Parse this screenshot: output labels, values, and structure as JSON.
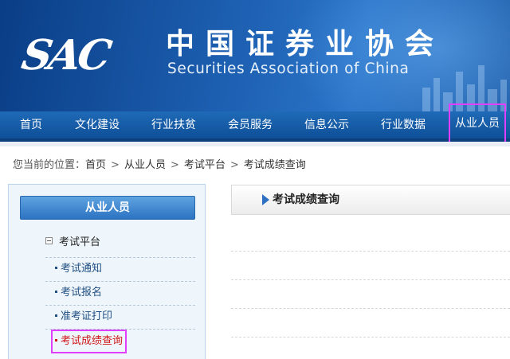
{
  "header": {
    "logo_text": "SAC",
    "name_cn": "中国证券业协会",
    "name_en": "Securities Association of China"
  },
  "nav": {
    "items": [
      {
        "label": "首页"
      },
      {
        "label": "文化建设"
      },
      {
        "label": "行业扶贫"
      },
      {
        "label": "会员服务"
      },
      {
        "label": "信息公示"
      },
      {
        "label": "行业数据"
      },
      {
        "label": "从业人员"
      }
    ],
    "highlighted": "从业人员"
  },
  "breadcrumb": {
    "prefix": "您当前的位置：",
    "items": [
      "首页",
      "从业人员",
      "考试平台",
      "考试成绩查询"
    ],
    "separator": ">"
  },
  "sidebar": {
    "heading": "从业人员",
    "group_label": "考试平台",
    "links": [
      {
        "label": "考试通知"
      },
      {
        "label": "考试报名"
      },
      {
        "label": "准考证打印"
      },
      {
        "label": "考试成绩查询"
      }
    ]
  },
  "main": {
    "title": "考试成绩查询"
  },
  "colors": {
    "banner_dark": "#0a3e86",
    "nav_blue": "#1f6ab7",
    "active_link": "#d01818",
    "highlight_box": "#e040fb"
  }
}
